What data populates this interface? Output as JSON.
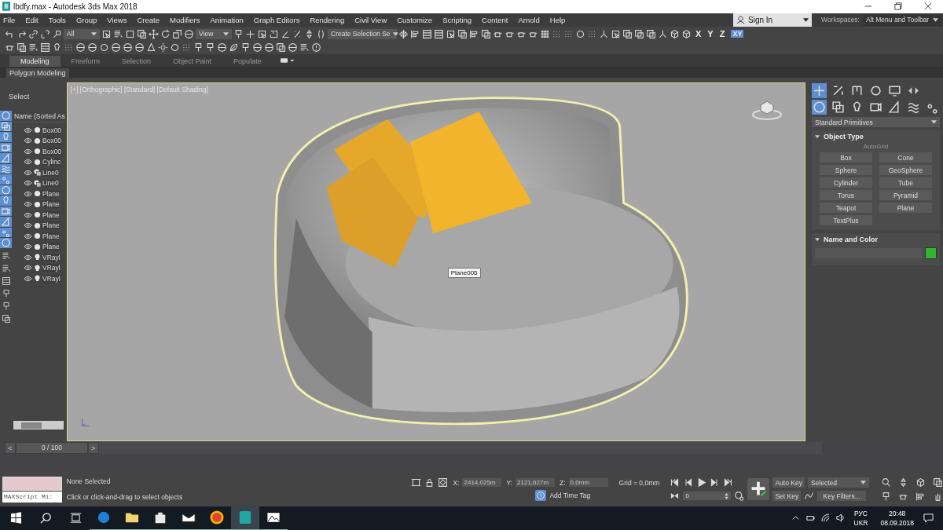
{
  "window": {
    "title": "lbdfy.max - Autodesk 3ds Max 2018"
  },
  "menu": [
    "File",
    "Edit",
    "Tools",
    "Group",
    "Views",
    "Create",
    "Modifiers",
    "Animation",
    "Graph Editors",
    "Rendering",
    "Civil View",
    "Customize",
    "Scripting",
    "Content",
    "Arnold",
    "Help"
  ],
  "sign_in": {
    "label": "Sign In"
  },
  "workspaces": {
    "label": "Workspaces:",
    "value": "Alt Menu and Toolbar"
  },
  "main_toolbar": {
    "selection_filter": "All",
    "reference_coord": "View",
    "named_selection": "Create Selection Se",
    "axes": [
      "X",
      "Y",
      "Z"
    ],
    "plane": "XY"
  },
  "ribbon": {
    "tabs": [
      {
        "label": "Modeling",
        "selected": true
      },
      {
        "label": "Freeform",
        "selected": false
      },
      {
        "label": "Selection",
        "selected": false
      },
      {
        "label": "Object Paint",
        "selected": false
      },
      {
        "label": "Populate",
        "selected": false
      }
    ],
    "panel": "Polygon Modeling"
  },
  "scene_explorer": {
    "title": "Select",
    "column": "Name (Sorted As",
    "items": [
      {
        "name": "Box00",
        "kind": "geometry"
      },
      {
        "name": "Box00",
        "kind": "geometry"
      },
      {
        "name": "Box00",
        "kind": "geometry"
      },
      {
        "name": "Cylinc",
        "kind": "geometry"
      },
      {
        "name": "Line0",
        "kind": "shape"
      },
      {
        "name": "Line0",
        "kind": "shape"
      },
      {
        "name": "Plane",
        "kind": "geometry"
      },
      {
        "name": "Plane",
        "kind": "geometry"
      },
      {
        "name": "Plane",
        "kind": "geometry"
      },
      {
        "name": "Plane",
        "kind": "geometry"
      },
      {
        "name": "Plane",
        "kind": "geometry"
      },
      {
        "name": "Plane",
        "kind": "geometry"
      },
      {
        "name": "VRayl",
        "kind": "light"
      },
      {
        "name": "VRayl",
        "kind": "light"
      },
      {
        "name": "VRayl",
        "kind": "light"
      }
    ]
  },
  "viewport": {
    "label": "[+] [Orthographic] [Standard] [Default Shading]",
    "tooltip": "Plane005"
  },
  "command_panel": {
    "tabs": [
      {
        "kind": "create",
        "selected": true
      },
      {
        "kind": "modify",
        "selected": false
      },
      {
        "kind": "hierarchy",
        "selected": false
      },
      {
        "kind": "motion",
        "selected": false
      },
      {
        "kind": "display",
        "selected": false
      }
    ],
    "categories": [
      {
        "kind": "geometry",
        "selected": true
      },
      {
        "kind": "shapes",
        "selected": false
      },
      {
        "kind": "lights",
        "selected": false
      },
      {
        "kind": "cameras",
        "selected": false
      },
      {
        "kind": "helpers",
        "selected": false
      },
      {
        "kind": "spacewarps",
        "selected": false
      },
      {
        "kind": "systems",
        "selected": false
      }
    ],
    "category_dropdown": "Standard Primitives",
    "object_type": {
      "title": "Object Type",
      "autogrid": {
        "label": "AutoGrid",
        "disabled": true
      },
      "buttons": [
        "Box",
        "Cone",
        "Sphere",
        "GeoSphere",
        "Cylinder",
        "Tube",
        "Torus",
        "Pyramid",
        "Teapot",
        "Plane",
        "TextPlus"
      ]
    },
    "name_and_color": {
      "title": "Name and Color",
      "color": "#2fb52f"
    }
  },
  "time_slider": {
    "prev": "<",
    "position": "0 / 100",
    "level": 0,
    "next": ">"
  },
  "status": {
    "listener": "MAXScript Mi:",
    "selection": "None Selected",
    "prompt": "Click or click-and-drag to select objects",
    "x_label": "X:",
    "x": "2414,025m",
    "y_label": "Y:",
    "y": "2121,627m",
    "z_label": "Z:",
    "z": "0,0mm",
    "grid": "Grid = 0,0mm",
    "time_tag": "Add Time Tag"
  },
  "animation": {
    "frame": "0",
    "auto_key": "Auto Key",
    "set_key": "Set Key",
    "key_mode": "Selected",
    "key_filters": "Key Filters..."
  },
  "taskbar": {
    "apps": [
      {
        "kind": "edge",
        "selected": false
      },
      {
        "kind": "folder",
        "selected": false
      },
      {
        "kind": "store",
        "selected": false
      },
      {
        "kind": "mail",
        "selected": false
      },
      {
        "kind": "chrome",
        "selected": false
      },
      {
        "kind": "max",
        "selected": true
      },
      {
        "kind": "photos",
        "selected": false
      }
    ],
    "language": "РУС",
    "layout": "UKR",
    "time": "20:48",
    "date": "08.09.2018"
  }
}
